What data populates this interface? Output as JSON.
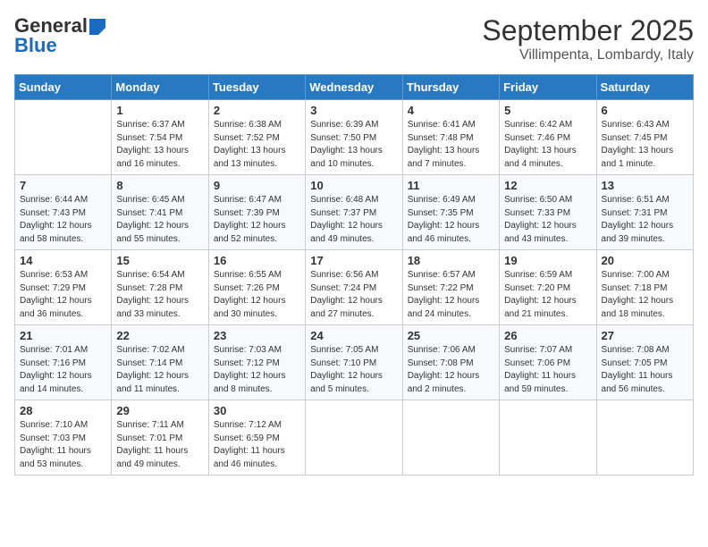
{
  "header": {
    "logo_line1": "General",
    "logo_line2": "Blue",
    "month": "September 2025",
    "location": "Villimpenta, Lombardy, Italy"
  },
  "days_of_week": [
    "Sunday",
    "Monday",
    "Tuesday",
    "Wednesday",
    "Thursday",
    "Friday",
    "Saturday"
  ],
  "weeks": [
    [
      {
        "day": null,
        "info": null
      },
      {
        "day": "1",
        "info": "Sunrise: 6:37 AM\nSunset: 7:54 PM\nDaylight: 13 hours\nand 16 minutes."
      },
      {
        "day": "2",
        "info": "Sunrise: 6:38 AM\nSunset: 7:52 PM\nDaylight: 13 hours\nand 13 minutes."
      },
      {
        "day": "3",
        "info": "Sunrise: 6:39 AM\nSunset: 7:50 PM\nDaylight: 13 hours\nand 10 minutes."
      },
      {
        "day": "4",
        "info": "Sunrise: 6:41 AM\nSunset: 7:48 PM\nDaylight: 13 hours\nand 7 minutes."
      },
      {
        "day": "5",
        "info": "Sunrise: 6:42 AM\nSunset: 7:46 PM\nDaylight: 13 hours\nand 4 minutes."
      },
      {
        "day": "6",
        "info": "Sunrise: 6:43 AM\nSunset: 7:45 PM\nDaylight: 13 hours\nand 1 minute."
      }
    ],
    [
      {
        "day": "7",
        "info": "Sunrise: 6:44 AM\nSunset: 7:43 PM\nDaylight: 12 hours\nand 58 minutes."
      },
      {
        "day": "8",
        "info": "Sunrise: 6:45 AM\nSunset: 7:41 PM\nDaylight: 12 hours\nand 55 minutes."
      },
      {
        "day": "9",
        "info": "Sunrise: 6:47 AM\nSunset: 7:39 PM\nDaylight: 12 hours\nand 52 minutes."
      },
      {
        "day": "10",
        "info": "Sunrise: 6:48 AM\nSunset: 7:37 PM\nDaylight: 12 hours\nand 49 minutes."
      },
      {
        "day": "11",
        "info": "Sunrise: 6:49 AM\nSunset: 7:35 PM\nDaylight: 12 hours\nand 46 minutes."
      },
      {
        "day": "12",
        "info": "Sunrise: 6:50 AM\nSunset: 7:33 PM\nDaylight: 12 hours\nand 43 minutes."
      },
      {
        "day": "13",
        "info": "Sunrise: 6:51 AM\nSunset: 7:31 PM\nDaylight: 12 hours\nand 39 minutes."
      }
    ],
    [
      {
        "day": "14",
        "info": "Sunrise: 6:53 AM\nSunset: 7:29 PM\nDaylight: 12 hours\nand 36 minutes."
      },
      {
        "day": "15",
        "info": "Sunrise: 6:54 AM\nSunset: 7:28 PM\nDaylight: 12 hours\nand 33 minutes."
      },
      {
        "day": "16",
        "info": "Sunrise: 6:55 AM\nSunset: 7:26 PM\nDaylight: 12 hours\nand 30 minutes."
      },
      {
        "day": "17",
        "info": "Sunrise: 6:56 AM\nSunset: 7:24 PM\nDaylight: 12 hours\nand 27 minutes."
      },
      {
        "day": "18",
        "info": "Sunrise: 6:57 AM\nSunset: 7:22 PM\nDaylight: 12 hours\nand 24 minutes."
      },
      {
        "day": "19",
        "info": "Sunrise: 6:59 AM\nSunset: 7:20 PM\nDaylight: 12 hours\nand 21 minutes."
      },
      {
        "day": "20",
        "info": "Sunrise: 7:00 AM\nSunset: 7:18 PM\nDaylight: 12 hours\nand 18 minutes."
      }
    ],
    [
      {
        "day": "21",
        "info": "Sunrise: 7:01 AM\nSunset: 7:16 PM\nDaylight: 12 hours\nand 14 minutes."
      },
      {
        "day": "22",
        "info": "Sunrise: 7:02 AM\nSunset: 7:14 PM\nDaylight: 12 hours\nand 11 minutes."
      },
      {
        "day": "23",
        "info": "Sunrise: 7:03 AM\nSunset: 7:12 PM\nDaylight: 12 hours\nand 8 minutes."
      },
      {
        "day": "24",
        "info": "Sunrise: 7:05 AM\nSunset: 7:10 PM\nDaylight: 12 hours\nand 5 minutes."
      },
      {
        "day": "25",
        "info": "Sunrise: 7:06 AM\nSunset: 7:08 PM\nDaylight: 12 hours\nand 2 minutes."
      },
      {
        "day": "26",
        "info": "Sunrise: 7:07 AM\nSunset: 7:06 PM\nDaylight: 11 hours\nand 59 minutes."
      },
      {
        "day": "27",
        "info": "Sunrise: 7:08 AM\nSunset: 7:05 PM\nDaylight: 11 hours\nand 56 minutes."
      }
    ],
    [
      {
        "day": "28",
        "info": "Sunrise: 7:10 AM\nSunset: 7:03 PM\nDaylight: 11 hours\nand 53 minutes."
      },
      {
        "day": "29",
        "info": "Sunrise: 7:11 AM\nSunset: 7:01 PM\nDaylight: 11 hours\nand 49 minutes."
      },
      {
        "day": "30",
        "info": "Sunrise: 7:12 AM\nSunset: 6:59 PM\nDaylight: 11 hours\nand 46 minutes."
      },
      {
        "day": null,
        "info": null
      },
      {
        "day": null,
        "info": null
      },
      {
        "day": null,
        "info": null
      },
      {
        "day": null,
        "info": null
      }
    ]
  ]
}
